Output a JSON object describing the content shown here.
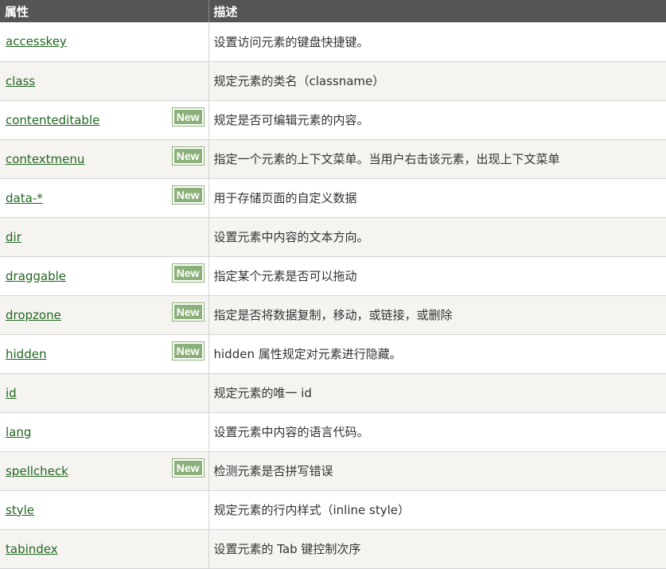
{
  "table": {
    "headers": {
      "attr": "属性",
      "desc": "描述"
    },
    "new_label": "New",
    "colors": {
      "header_bg": "#555555",
      "link": "#226622",
      "badge_bg": "#8cb07a",
      "alt_row": "#f6f4f0"
    },
    "rows": [
      {
        "attr": "accesskey",
        "desc": "设置访问元素的键盘快捷键。",
        "new": false
      },
      {
        "attr": "class",
        "desc": "规定元素的类名（classname）",
        "new": false
      },
      {
        "attr": "contenteditable",
        "desc": "规定是否可编辑元素的内容。",
        "new": true
      },
      {
        "attr": "contextmenu",
        "desc": "指定一个元素的上下文菜单。当用户右击该元素，出现上下文菜单",
        "new": true
      },
      {
        "attr": "data-*",
        "desc": "用于存储页面的自定义数据",
        "new": true
      },
      {
        "attr": "dir",
        "desc": "设置元素中内容的文本方向。",
        "new": false
      },
      {
        "attr": "draggable",
        "desc": "指定某个元素是否可以拖动",
        "new": true
      },
      {
        "attr": "dropzone",
        "desc": "指定是否将数据复制，移动，或链接，或删除",
        "new": true
      },
      {
        "attr": "hidden",
        "desc": "hidden 属性规定对元素进行隐藏。",
        "new": true
      },
      {
        "attr": "id",
        "desc": "规定元素的唯一 id",
        "new": false
      },
      {
        "attr": "lang",
        "desc": "设置元素中内容的语言代码。",
        "new": false
      },
      {
        "attr": "spellcheck",
        "desc": "检测元素是否拼写错误",
        "new": true
      },
      {
        "attr": "style",
        "desc": "规定元素的行内样式（inline style）",
        "new": false
      },
      {
        "attr": "tabindex",
        "desc": "设置元素的 Tab 键控制次序",
        "new": false
      }
    ]
  }
}
